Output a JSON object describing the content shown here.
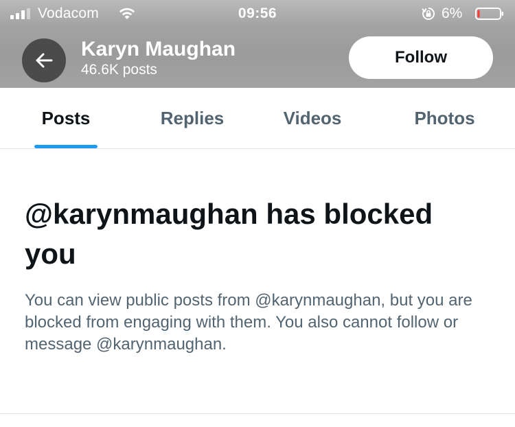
{
  "status_bar": {
    "carrier": "Vodacom",
    "time": "09:56",
    "battery_percent": "6%",
    "battery_level": 0.06,
    "battery_color": "#ff3b30",
    "icons": [
      "signal-icon",
      "wifi-icon",
      "orientation-lock-icon",
      "battery-icon"
    ]
  },
  "profile_header": {
    "back_icon": "arrow-left-icon",
    "name": "Karyn Maughan",
    "post_count": "46.6K posts",
    "follow_label": "Follow"
  },
  "tabs": [
    {
      "label": "Posts",
      "active": true
    },
    {
      "label": "Replies",
      "active": false
    },
    {
      "label": "Videos",
      "active": false
    },
    {
      "label": "Photos",
      "active": false
    }
  ],
  "blocked": {
    "title": "@karynmaughan has blocked you",
    "description": "You can view public posts from @karynmaughan, but you are blocked from engaging with them. You also cannot follow or message @karynmaughan."
  },
  "colors": {
    "accent": "#1d9bf0",
    "text_primary": "#0f1419",
    "text_secondary": "#536471",
    "header_overlay": "#a3a3a3"
  }
}
